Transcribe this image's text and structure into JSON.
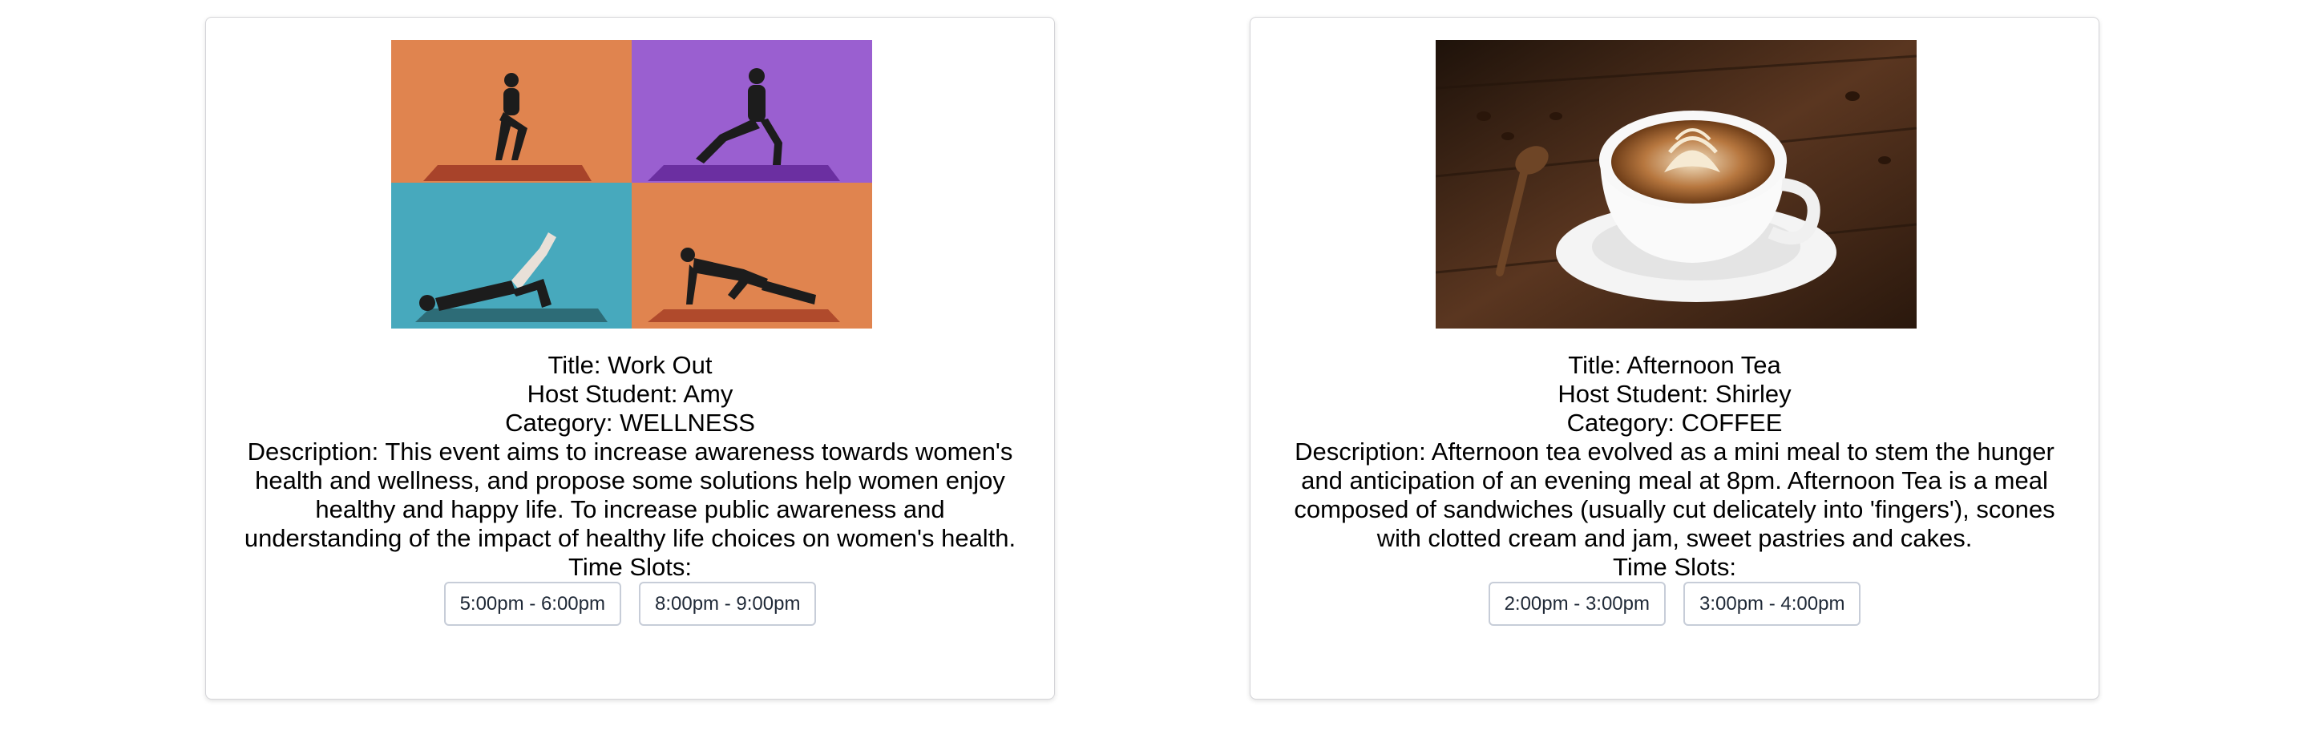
{
  "events": [
    {
      "title_label": "Title:",
      "title": "Work Out",
      "host_label": "Host Student:",
      "host": "Amy",
      "category_label": "Category:",
      "category": "WELLNESS",
      "description_label": "Description:",
      "description": "This event aims to increase awareness towards women's health and wellness, and propose some solutions help women enjoy healthy and happy life. To increase public awareness and understanding of the impact of healthy life choices on women's health.",
      "time_slots_label": "Time Slots:",
      "time_slots": [
        "5:00pm - 6:00pm",
        "8:00pm - 9:00pm"
      ]
    },
    {
      "title_label": "Title:",
      "title": "Afternoon Tea",
      "host_label": "Host Student:",
      "host": "Shirley",
      "category_label": "Category:",
      "category": "COFFEE",
      "description_label": "Description:",
      "description": "Afternoon tea evolved as a mini meal to stem the hunger and anticipation of an evening meal at 8pm. Afternoon Tea is a meal composed of sandwiches (usually cut delicately into 'fingers'), scones with clotted cream and jam, sweet pastries and cakes.",
      "time_slots_label": "Time Slots:",
      "time_slots": [
        "2:00pm - 3:00pm",
        "3:00pm - 4:00pm"
      ]
    }
  ],
  "colors": {
    "orange_panel": "#e0844f",
    "purple_panel": "#9a5fd0",
    "teal_panel": "#47a9bd",
    "coffee_wood": "#3b2314",
    "slot_border": "#c7cdd8"
  }
}
